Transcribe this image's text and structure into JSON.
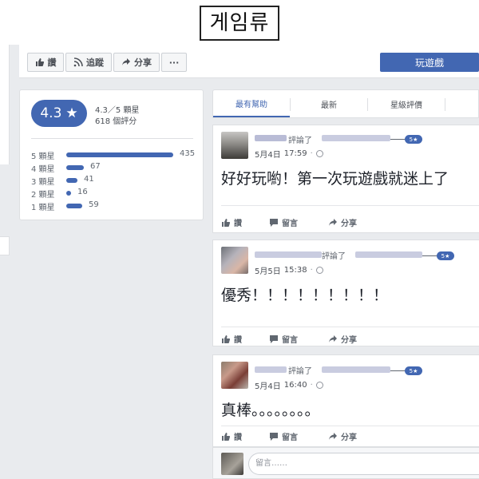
{
  "overlay_title": "게임류",
  "action_bar": {
    "like_label": "讚",
    "follow_label": "追蹤",
    "share_label": "分享",
    "more_label": "···",
    "play_label": "玩遊戲"
  },
  "rating": {
    "score": "4.3",
    "star": "★",
    "summary": "4.3／5 顆星",
    "count_text": "618 個評分",
    "rows": [
      {
        "label": "5 顆星",
        "count": "435",
        "value": 435
      },
      {
        "label": "4 顆星",
        "count": "67",
        "value": 67
      },
      {
        "label": "3 顆星",
        "count": "41",
        "value": 41
      },
      {
        "label": "2 顆星",
        "count": "16",
        "value": 16
      },
      {
        "label": "1 顆星",
        "count": "59",
        "value": 59
      }
    ]
  },
  "tabs": [
    {
      "label": "最有幫助",
      "active": true
    },
    {
      "label": "最新",
      "active": false
    },
    {
      "label": "星級評價",
      "active": false
    }
  ],
  "reviews": [
    {
      "commented": "評論了",
      "stars": "5★",
      "date": "5月4日",
      "time": "17:59",
      "text": "好好玩喲！第一次玩遊戲就迷上了"
    },
    {
      "commented": "評論了",
      "stars": "5★",
      "date": "5月5日",
      "time": "15:38",
      "text": "優秀！！！！！！！！！"
    },
    {
      "commented": "評論了",
      "stars": "5★",
      "date": "5月4日",
      "time": "16:40",
      "text": "真棒。。。。。。。。"
    }
  ],
  "review_actions": {
    "like": "讚",
    "comment": "留言",
    "share": "分享"
  },
  "comment_box": {
    "placeholder": "留言……"
  },
  "colors": {
    "accent": "#4267b2",
    "background": "#e9ebee"
  }
}
